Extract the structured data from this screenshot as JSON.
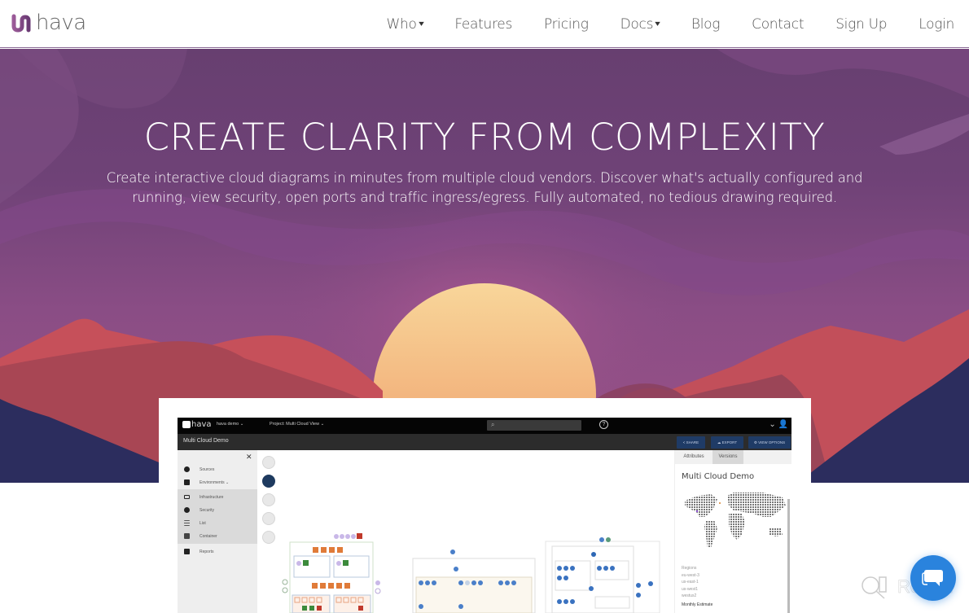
{
  "nav": {
    "brand": "hava",
    "links": [
      {
        "label": "Who",
        "dropdown": true
      },
      {
        "label": "Features",
        "dropdown": false
      },
      {
        "label": "Pricing",
        "dropdown": false
      },
      {
        "label": "Docs",
        "dropdown": true
      },
      {
        "label": "Blog",
        "dropdown": false
      },
      {
        "label": "Contact",
        "dropdown": false
      },
      {
        "label": "Sign Up",
        "dropdown": false
      },
      {
        "label": "Login",
        "dropdown": false
      }
    ],
    "chevron_glyph": "❯"
  },
  "hero": {
    "title": "CREATE CLARITY FROM COMPLEXITY",
    "subtitle": "Create interactive cloud diagrams in minutes from multiple cloud vendors. Discover what's actually configured and running, view security, open ports and traffic ingress/egress. Fully automated, no tedious drawing required.",
    "colors": {
      "sky": "#6f4277",
      "sun": "#f6c58a",
      "mountain_red": "#c9525a",
      "mountain_navy": "#2c2c5c"
    }
  },
  "app_preview": {
    "brand": "hava",
    "account_menu": "hava demo ⌄",
    "project_menu": "Project: Multi Cloud View ⌄",
    "search_icon": "🔍",
    "help_icon": "?",
    "user_icon": "⌄ 👤",
    "page_title": "Multi Cloud Demo",
    "buttons": [
      "< SHARE",
      "☁ EXPORT",
      "⚙ VIEW OPTIONS"
    ],
    "sidebar": {
      "close": "✕",
      "items": [
        "Sources",
        "Environments ⌄",
        "Infrastructure",
        "Security",
        "List",
        "Container",
        "Reports"
      ]
    },
    "panel": {
      "tabs": [
        "Attributes",
        "Versions"
      ],
      "title": "Multi Cloud Demo",
      "regions_label": "Regions",
      "regions": [
        "eu-west-3",
        "us-east-1",
        "us-west1",
        "westus2"
      ],
      "footer": "Monthly Estimate"
    }
  },
  "widgets": {
    "chat_icon": "chat-bubble",
    "watermark": "Revain"
  }
}
